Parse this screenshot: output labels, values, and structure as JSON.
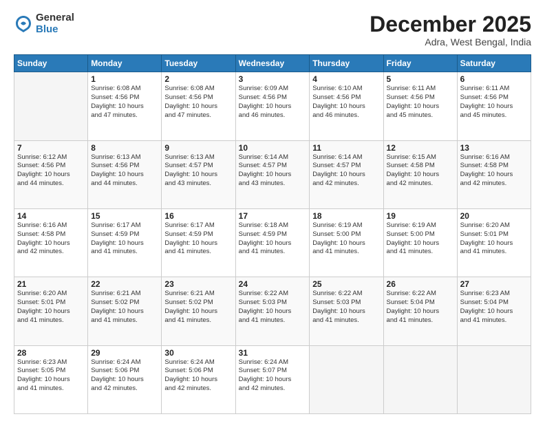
{
  "logo": {
    "general": "General",
    "blue": "Blue"
  },
  "header": {
    "month": "December 2025",
    "location": "Adra, West Bengal, India"
  },
  "weekdays": [
    "Sunday",
    "Monday",
    "Tuesday",
    "Wednesday",
    "Thursday",
    "Friday",
    "Saturday"
  ],
  "weeks": [
    [
      {
        "day": "",
        "info": ""
      },
      {
        "day": "1",
        "info": "Sunrise: 6:08 AM\nSunset: 4:56 PM\nDaylight: 10 hours\nand 47 minutes."
      },
      {
        "day": "2",
        "info": "Sunrise: 6:08 AM\nSunset: 4:56 PM\nDaylight: 10 hours\nand 47 minutes."
      },
      {
        "day": "3",
        "info": "Sunrise: 6:09 AM\nSunset: 4:56 PM\nDaylight: 10 hours\nand 46 minutes."
      },
      {
        "day": "4",
        "info": "Sunrise: 6:10 AM\nSunset: 4:56 PM\nDaylight: 10 hours\nand 46 minutes."
      },
      {
        "day": "5",
        "info": "Sunrise: 6:11 AM\nSunset: 4:56 PM\nDaylight: 10 hours\nand 45 minutes."
      },
      {
        "day": "6",
        "info": "Sunrise: 6:11 AM\nSunset: 4:56 PM\nDaylight: 10 hours\nand 45 minutes."
      }
    ],
    [
      {
        "day": "7",
        "info": "Sunrise: 6:12 AM\nSunset: 4:56 PM\nDaylight: 10 hours\nand 44 minutes."
      },
      {
        "day": "8",
        "info": "Sunrise: 6:13 AM\nSunset: 4:56 PM\nDaylight: 10 hours\nand 44 minutes."
      },
      {
        "day": "9",
        "info": "Sunrise: 6:13 AM\nSunset: 4:57 PM\nDaylight: 10 hours\nand 43 minutes."
      },
      {
        "day": "10",
        "info": "Sunrise: 6:14 AM\nSunset: 4:57 PM\nDaylight: 10 hours\nand 43 minutes."
      },
      {
        "day": "11",
        "info": "Sunrise: 6:14 AM\nSunset: 4:57 PM\nDaylight: 10 hours\nand 42 minutes."
      },
      {
        "day": "12",
        "info": "Sunrise: 6:15 AM\nSunset: 4:58 PM\nDaylight: 10 hours\nand 42 minutes."
      },
      {
        "day": "13",
        "info": "Sunrise: 6:16 AM\nSunset: 4:58 PM\nDaylight: 10 hours\nand 42 minutes."
      }
    ],
    [
      {
        "day": "14",
        "info": "Sunrise: 6:16 AM\nSunset: 4:58 PM\nDaylight: 10 hours\nand 42 minutes."
      },
      {
        "day": "15",
        "info": "Sunrise: 6:17 AM\nSunset: 4:59 PM\nDaylight: 10 hours\nand 41 minutes."
      },
      {
        "day": "16",
        "info": "Sunrise: 6:17 AM\nSunset: 4:59 PM\nDaylight: 10 hours\nand 41 minutes."
      },
      {
        "day": "17",
        "info": "Sunrise: 6:18 AM\nSunset: 4:59 PM\nDaylight: 10 hours\nand 41 minutes."
      },
      {
        "day": "18",
        "info": "Sunrise: 6:19 AM\nSunset: 5:00 PM\nDaylight: 10 hours\nand 41 minutes."
      },
      {
        "day": "19",
        "info": "Sunrise: 6:19 AM\nSunset: 5:00 PM\nDaylight: 10 hours\nand 41 minutes."
      },
      {
        "day": "20",
        "info": "Sunrise: 6:20 AM\nSunset: 5:01 PM\nDaylight: 10 hours\nand 41 minutes."
      }
    ],
    [
      {
        "day": "21",
        "info": "Sunrise: 6:20 AM\nSunset: 5:01 PM\nDaylight: 10 hours\nand 41 minutes."
      },
      {
        "day": "22",
        "info": "Sunrise: 6:21 AM\nSunset: 5:02 PM\nDaylight: 10 hours\nand 41 minutes."
      },
      {
        "day": "23",
        "info": "Sunrise: 6:21 AM\nSunset: 5:02 PM\nDaylight: 10 hours\nand 41 minutes."
      },
      {
        "day": "24",
        "info": "Sunrise: 6:22 AM\nSunset: 5:03 PM\nDaylight: 10 hours\nand 41 minutes."
      },
      {
        "day": "25",
        "info": "Sunrise: 6:22 AM\nSunset: 5:03 PM\nDaylight: 10 hours\nand 41 minutes."
      },
      {
        "day": "26",
        "info": "Sunrise: 6:22 AM\nSunset: 5:04 PM\nDaylight: 10 hours\nand 41 minutes."
      },
      {
        "day": "27",
        "info": "Sunrise: 6:23 AM\nSunset: 5:04 PM\nDaylight: 10 hours\nand 41 minutes."
      }
    ],
    [
      {
        "day": "28",
        "info": "Sunrise: 6:23 AM\nSunset: 5:05 PM\nDaylight: 10 hours\nand 41 minutes."
      },
      {
        "day": "29",
        "info": "Sunrise: 6:24 AM\nSunset: 5:06 PM\nDaylight: 10 hours\nand 42 minutes."
      },
      {
        "day": "30",
        "info": "Sunrise: 6:24 AM\nSunset: 5:06 PM\nDaylight: 10 hours\nand 42 minutes."
      },
      {
        "day": "31",
        "info": "Sunrise: 6:24 AM\nSunset: 5:07 PM\nDaylight: 10 hours\nand 42 minutes."
      },
      {
        "day": "",
        "info": ""
      },
      {
        "day": "",
        "info": ""
      },
      {
        "day": "",
        "info": ""
      }
    ]
  ]
}
